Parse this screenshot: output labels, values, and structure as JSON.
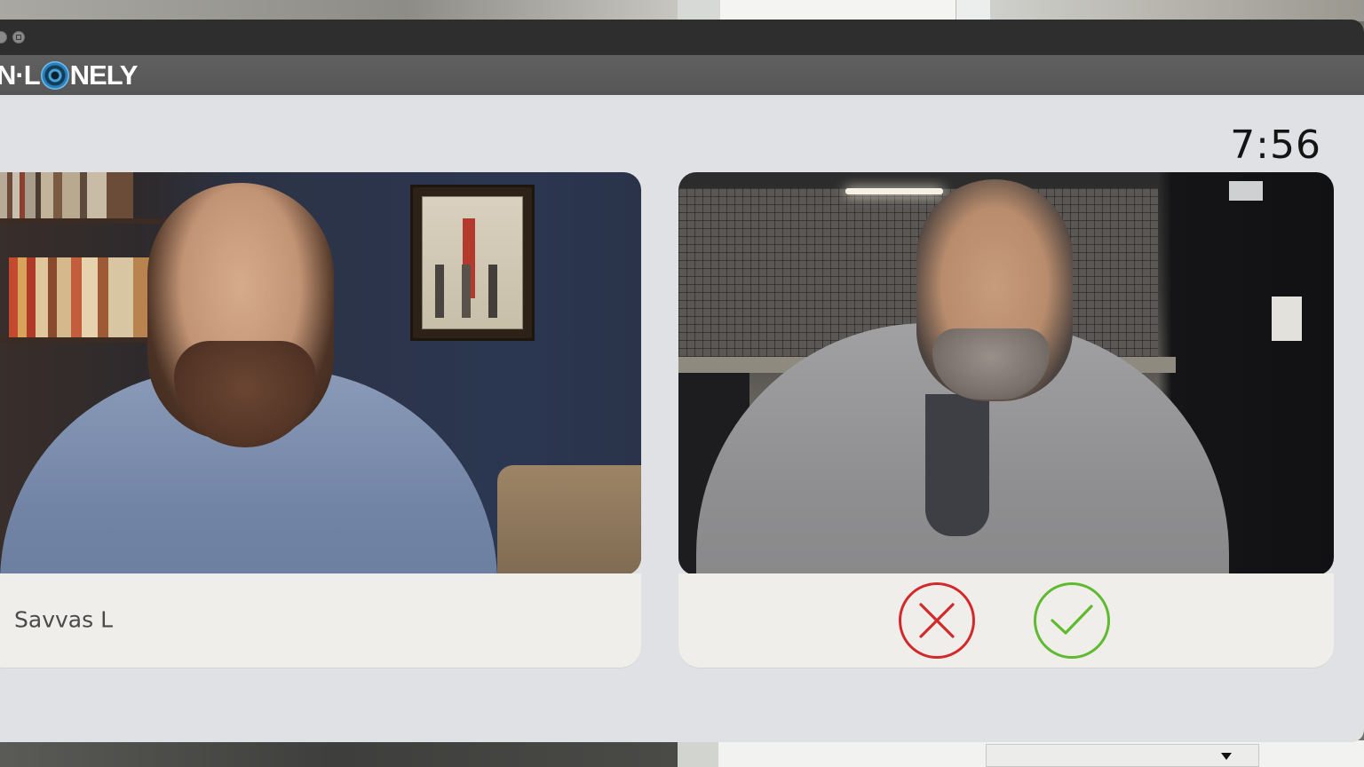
{
  "app": {
    "logo_prefix": "N·L",
    "logo_suffix": "NELY"
  },
  "call": {
    "timer": "7:56"
  },
  "profile": {
    "name": "Savvas L"
  },
  "actions": {
    "reject_icon": "x-circle-icon",
    "accept_icon": "check-circle-icon"
  },
  "colors": {
    "reject": "#d22a2a",
    "accept": "#5fba2f",
    "panel": "#dfe1e4",
    "header": "#5a5a5a"
  }
}
